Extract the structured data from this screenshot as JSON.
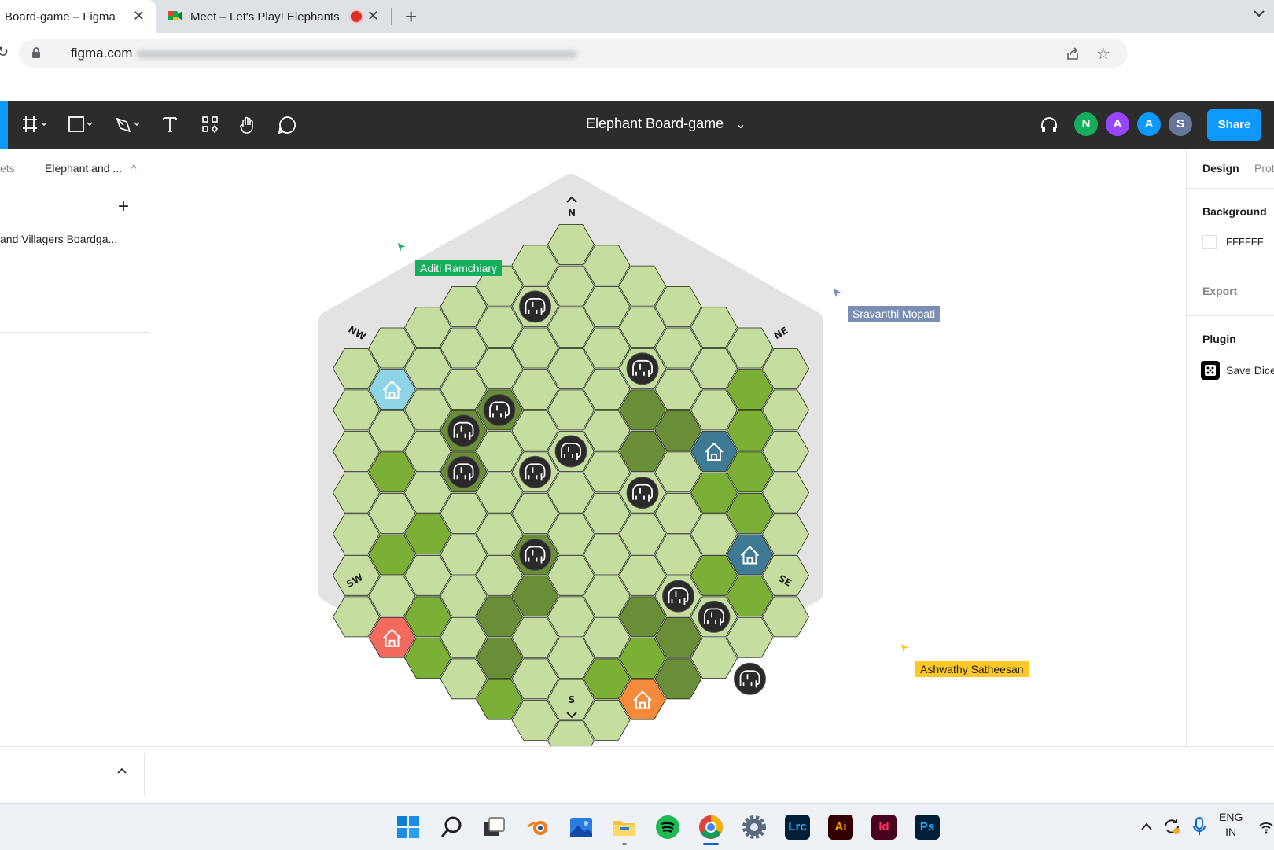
{
  "browser": {
    "tabs": [
      {
        "title": "Board-game – Figma",
        "close": "✕"
      },
      {
        "title": "Meet – Let's Play! Elephants",
        "close": "✕"
      }
    ],
    "new_tab": "+",
    "url_host": "figma.com"
  },
  "toolbar": {
    "title": "Elephant Board-game",
    "title_chevron": "⌄",
    "share_label": "Share",
    "avatars": [
      {
        "initial": "N",
        "color": "#14ae5c"
      },
      {
        "initial": "A",
        "color": "#9747ff"
      },
      {
        "initial": "A",
        "color": "#0d99ff"
      },
      {
        "initial": "S",
        "color": "#667799"
      }
    ]
  },
  "left_panel": {
    "tab_assets": "ets",
    "page_name": "Elephant and ...",
    "add_label": "+",
    "layer_name": "and Villagers Boardga..."
  },
  "right_panel": {
    "tab_design": "Design",
    "tab_prototype": "Prot",
    "background_title": "Background",
    "background_value": "FFFFFF",
    "export_title": "Export",
    "plugin_title": "Plugin",
    "plugin_name": "Save Dice"
  },
  "board": {
    "directions": {
      "n": "N",
      "s": "S",
      "ne": "NE",
      "nw": "NW",
      "se": "SE",
      "sw": "SW"
    },
    "colors": {
      "light": "#c5dd9e",
      "grass": "#7caf35",
      "forest": "#6a8d37",
      "token": "#2a2a2a",
      "home_cyan": "#8ed3e6",
      "home_blue": "#3f7a94",
      "home_red": "#f36b5f",
      "home_orange": "#f48a3c",
      "frame": "#e3e3e3"
    }
  },
  "cursors": [
    {
      "name": "Aditi Ramchiary",
      "color": "#14ae5c"
    },
    {
      "name": "Sravanthi Mopati",
      "color": "#7a8fb3"
    },
    {
      "name": "Ashwathy Satheesan",
      "color": "#ffc727"
    }
  ],
  "taskbar": {
    "lang_line1": "ENG",
    "lang_line2": "IN",
    "apps": [
      "start-icon",
      "search-icon",
      "taskview-icon",
      "blender-icon",
      "photos-icon",
      "files-icon",
      "spotify-icon",
      "chrome-icon",
      "settings-icon"
    ],
    "lrc": "Lrc",
    "ai": "Ai",
    "id": "Id",
    "ps": "Ps"
  }
}
